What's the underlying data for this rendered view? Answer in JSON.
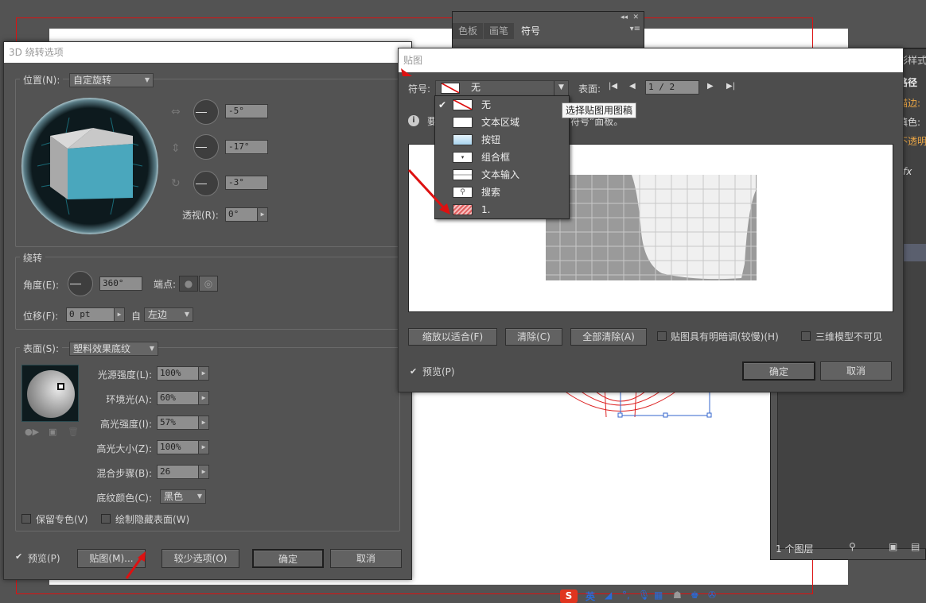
{
  "rotate_dialog": {
    "title": "3D 绕转选项",
    "position": {
      "label": "位置(N):",
      "value": "自定旋转"
    },
    "angles": [
      "-5°",
      "-17°",
      "-3°"
    ],
    "perspective": {
      "label": "透视(R):",
      "value": "0°"
    },
    "revolve": {
      "group_label": "绕转",
      "angle_label": "角度(E):",
      "angle_value": "360°",
      "cap_label": "端点:",
      "offset_label": "位移(F):",
      "offset_value": "0 pt",
      "from_label": "自",
      "from_value": "左边"
    },
    "surface": {
      "label": "表面(S):",
      "value": "塑料效果底纹",
      "params": [
        {
          "label": "光源强度(L):",
          "value": "100%"
        },
        {
          "label": "环境光(A):",
          "value": "60%"
        },
        {
          "label": "高光强度(I):",
          "value": "57%"
        },
        {
          "label": "高光大小(Z):",
          "value": "100%"
        },
        {
          "label": "混合步骤(B):",
          "value": "26"
        }
      ],
      "shade_color_label": "底纹颜色(C):",
      "shade_color_value": "黑色",
      "preserve_spot": "保留专色(V)",
      "draw_hidden": "绘制隐藏表面(W)"
    },
    "preview": "预览(P)",
    "buttons": {
      "map": "贴图(M)...",
      "fewer": "较少选项(O)",
      "ok": "确定",
      "cancel": "取消"
    }
  },
  "map_dialog": {
    "title": "贴图",
    "symbol_label": "符号:",
    "symbol_value": "无",
    "surface_label": "表面:",
    "surface_value": "1 / 2",
    "info_prefix": "要",
    "info_suffix": "符号”面板。",
    "tooltip": "选择贴图用图稿",
    "menu_items": [
      "无",
      "文本区域",
      "按钮",
      "组合框",
      "文本输入",
      "搜索",
      "1."
    ],
    "buttons": {
      "fit": "缩放以适合(F)",
      "clear": "清除(C)",
      "clear_all": "全部清除(A)",
      "ok": "确定",
      "cancel": "取消"
    },
    "shade_art": "贴图具有明暗调(较慢)(H)",
    "invisible_geometry": "三维模型不可见",
    "preview": "预览(P)"
  },
  "swatch_panel": {
    "tabs": [
      "色板",
      "画笔",
      "符号"
    ]
  },
  "right_panel": {
    "items": [
      "形样式",
      "路径",
      "描边:",
      "填色:",
      "不透明",
      "fx"
    ],
    "layers_count": "1 个图层"
  },
  "ime_bar": {
    "lang": "英"
  },
  "colors": {
    "accent_red": "#d11111",
    "cube": "#4aa7bd"
  }
}
